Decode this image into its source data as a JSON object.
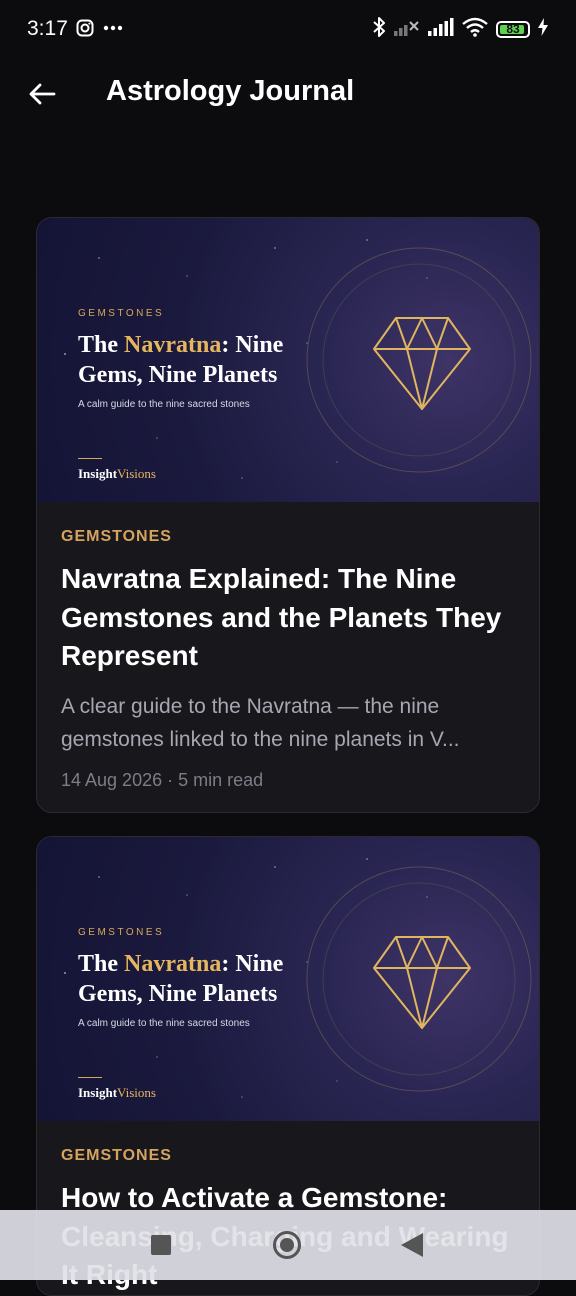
{
  "status_bar": {
    "time": "3:17",
    "battery_level": "83",
    "icons": [
      "instagram-icon",
      "more-dots-icon",
      "bluetooth-icon",
      "signal-no-service-icon",
      "signal-icon",
      "wifi-icon",
      "battery-icon",
      "charging-icon"
    ]
  },
  "app_bar": {
    "back_icon": "arrow-left-icon",
    "title": "Astrology Journal"
  },
  "articles": [
    {
      "image": {
        "tag": "GEMSTONES",
        "title_pre": "The ",
        "title_highlight": "Navratna",
        "title_post": ": Nine Gems, Nine Planets",
        "subtitle": "A calm guide to the nine sacred stones",
        "brand_bold": "Insight",
        "brand_accent": "Visions"
      },
      "category": "GEMSTONES",
      "title": "Navratna Explained: The Nine Gemstones and the Planets They Represent",
      "excerpt": "A clear guide to the Navratna — the nine gemstones linked to the nine planets in V...",
      "meta": "14 Aug 2026 · 5 min read"
    },
    {
      "image": {
        "tag": "GEMSTONES",
        "title_pre": "The ",
        "title_highlight": "Navratna",
        "title_post": ": Nine Gems, Nine Planets",
        "subtitle": "A calm guide to the nine sacred stones",
        "brand_bold": "Insight",
        "brand_accent": "Visions"
      },
      "category": "GEMSTONES",
      "title": "How to Activate a Gemstone: Cleansing, Charging and Wearing It Right"
    }
  ],
  "nav_bar": {
    "icons": [
      "recents-square-icon",
      "home-circle-icon",
      "back-triangle-icon"
    ]
  },
  "colors": {
    "background": "#0c0c0f",
    "card": "#17171c",
    "accent_gold": "#d6a35e",
    "battery_green": "#5ed150"
  }
}
